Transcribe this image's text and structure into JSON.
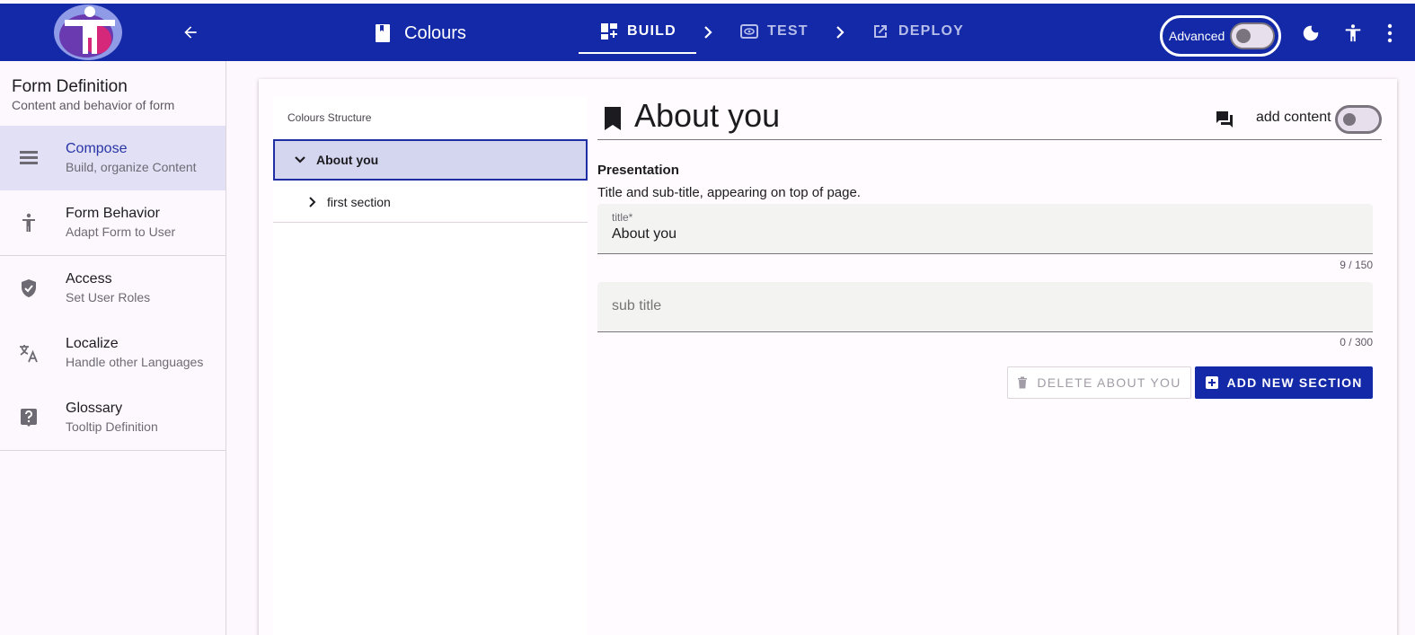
{
  "header": {
    "form_name": "Colours",
    "steps": [
      {
        "label": "BUILD",
        "icon": "build-icon",
        "active": true
      },
      {
        "label": "TEST",
        "icon": "eye-icon",
        "active": false
      },
      {
        "label": "DEPLOY",
        "icon": "open-external-icon",
        "active": false
      }
    ],
    "advanced_label": "Advanced",
    "advanced_on": false,
    "icons": [
      "logo",
      "back-arrow-icon",
      "book-icon",
      "chevron-right-icon",
      "dark-mode-icon",
      "accessibility-icon",
      "more-vert-icon"
    ]
  },
  "sidebar": {
    "title": "Form Definition",
    "subtitle": "Content and behavior of form",
    "items": [
      {
        "label": "Compose",
        "sub": "Build, organize Content",
        "icon": "compose-icon",
        "active": true
      },
      {
        "label": "Form Behavior",
        "sub": "Adapt Form to User",
        "icon": "accessibility-icon",
        "active": false
      },
      {
        "label": "Access",
        "sub": "Set User Roles",
        "icon": "shield-check-icon",
        "active": false
      },
      {
        "label": "Localize",
        "sub": "Handle other Languages",
        "icon": "translate-icon",
        "active": false
      },
      {
        "label": "Glossary",
        "sub": "Tooltip Definition",
        "icon": "help-icon",
        "active": false
      }
    ]
  },
  "structure": {
    "heading": "Colours Structure",
    "nodes": [
      {
        "label": "About you",
        "expanded": true,
        "selected": true
      },
      {
        "label": "first section",
        "expanded": false,
        "selected": false
      }
    ]
  },
  "editor": {
    "title": "About you",
    "add_content_label": "add content",
    "add_content_on": false,
    "section_label": "Presentation",
    "section_desc": "Title and sub-title, appearing on top of page.",
    "title_field": {
      "label": "title*",
      "value": "About you",
      "counter": "9 / 150"
    },
    "subtitle_field": {
      "placeholder": "sub title",
      "value": "",
      "counter": "0 / 300"
    },
    "delete_button": "DELETE ABOUT YOU",
    "add_button": "ADD NEW SECTION"
  },
  "colors": {
    "primary": "#1329a8",
    "selected_bg": "#d4d6ef",
    "active_nav_bg": "#e1e0f5",
    "page_bg": "#fdf8fd"
  }
}
